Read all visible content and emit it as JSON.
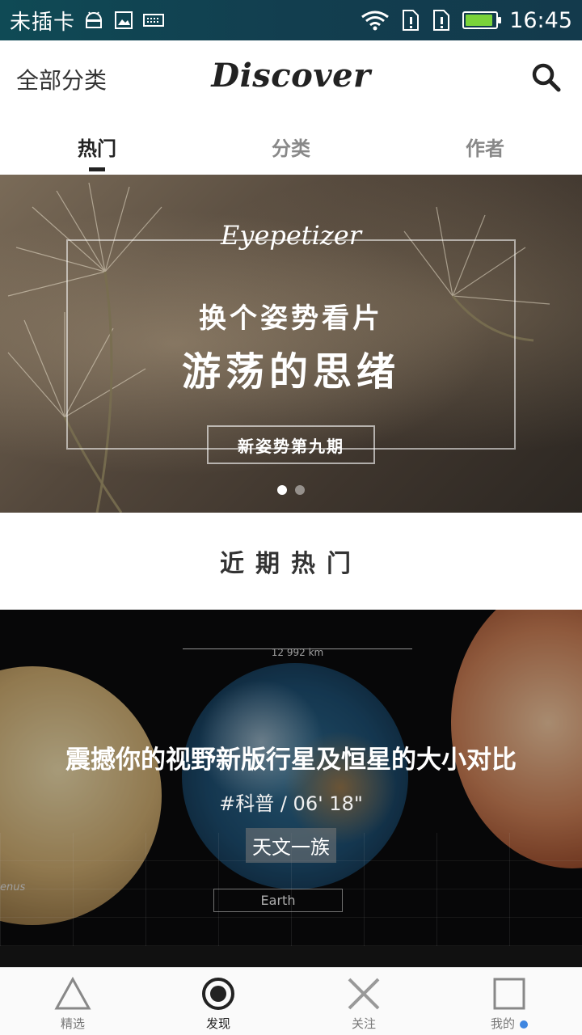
{
  "statusbar": {
    "carrier": "未插卡",
    "time": "16:45",
    "icons": [
      "android-icon",
      "image-icon",
      "keyboard-icon",
      "wifi-icon",
      "sim-alert-icon",
      "sim-alert-icon",
      "battery-icon"
    ],
    "battery_level": 0.9,
    "battery_color": "#7ad33a"
  },
  "header": {
    "left_label": "全部分类",
    "title": "Discover",
    "search_icon": "search-icon"
  },
  "tabs": [
    {
      "label": "热门",
      "active": true
    },
    {
      "label": "分类",
      "active": false
    },
    {
      "label": "作者",
      "active": false
    }
  ],
  "banner": {
    "brand": "Eyepetizer",
    "line1": "换个姿势看片",
    "line2": "游荡的思绪",
    "badge": "新姿势第九期",
    "dots": 2,
    "active_dot": 0
  },
  "section": {
    "title": "近期热门"
  },
  "video_card": {
    "title": "震撼你的视野新版行星及恒星的大小对比",
    "meta": "#科普  /  06' 18\"",
    "author": "天文一族",
    "measure_text": "12 992 km",
    "earth_label": "Earth",
    "venus_label": "enus"
  },
  "bottomnav": [
    {
      "label": "精选",
      "icon": "triangle-icon",
      "active": false
    },
    {
      "label": "发现",
      "icon": "target-circle-icon",
      "active": true
    },
    {
      "label": "关注",
      "icon": "cross-icon",
      "active": false
    },
    {
      "label": "我的",
      "icon": "square-icon",
      "active": false,
      "notification": true
    }
  ],
  "colors": {
    "accent_dot": "#3f86e0",
    "statusbar": "#123e4f"
  }
}
